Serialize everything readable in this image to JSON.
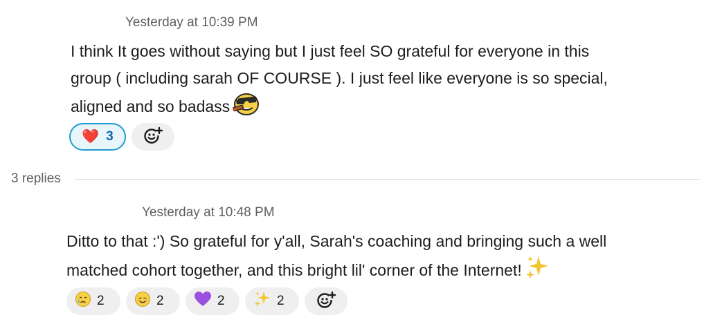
{
  "message1": {
    "timestamp": "Yesterday at 10:39 PM",
    "lines": [
      "I think It goes without saying but I just feel SO grateful for everyone in this",
      "group ( including sarah OF COURSE ). I just feel like everyone is so special,",
      "aligned and so badass"
    ],
    "inline_emoji_icon": "cool-cigar-face-emoji-icon",
    "reactions": [
      {
        "icon": "red-heart-icon",
        "emoji": "❤️",
        "count": "3",
        "reacted_by_me": true
      }
    ],
    "add_reaction_icon": "add-reaction-icon"
  },
  "thread": {
    "replies_label": "3 replies"
  },
  "message2": {
    "timestamp": "Yesterday at 10:48 PM",
    "lines": [
      "Ditto to that :') So grateful for y'all, Sarah's coaching and bringing such a well",
      "matched cohort together, and this bright lil' corner of the Internet!"
    ],
    "inline_emoji_icon": "sparkles-icon",
    "reactions": [
      {
        "icon": "crying-face-icon",
        "emoji": "😢",
        "count": "2",
        "reacted_by_me": false
      },
      {
        "icon": "relieved-smiling-face-icon",
        "emoji": "☺️",
        "count": "2",
        "reacted_by_me": false
      },
      {
        "icon": "purple-heart-icon",
        "emoji": "💜",
        "count": "2",
        "reacted_by_me": false
      },
      {
        "icon": "sparkles-icon",
        "emoji": "✨",
        "count": "2",
        "reacted_by_me": false
      }
    ],
    "add_reaction_icon": "add-reaction-icon"
  },
  "colors": {
    "text": "#1d1c1d",
    "muted": "#616061",
    "pill_bg": "#efefef",
    "active_pill_bg": "#e8f5fa",
    "active_pill_border": "#1d9bd1",
    "active_count": "#1264a3",
    "divider": "#dddddd"
  }
}
